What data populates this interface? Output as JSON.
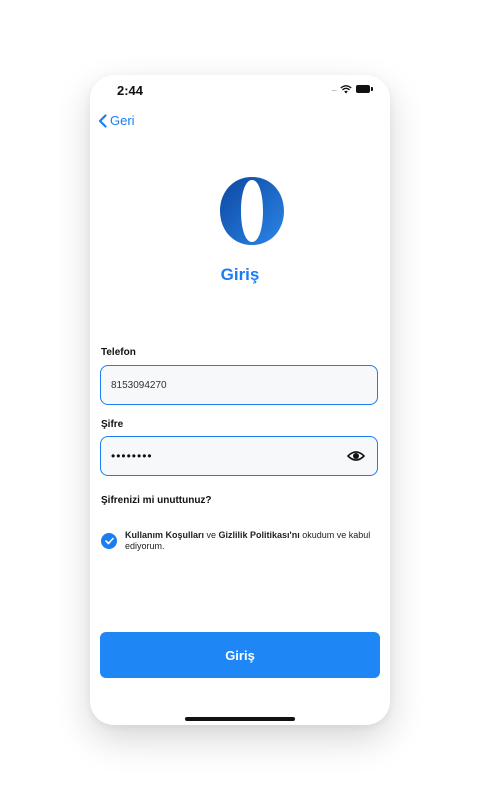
{
  "status_bar": {
    "time": "2:44",
    "signal_dots": "....",
    "icons": [
      "signal-dots-icon",
      "wifi-icon",
      "battery-icon"
    ]
  },
  "nav": {
    "back_label": "Geri",
    "back_icon": "chevron-left-icon"
  },
  "logo": {
    "icon": "brand-logo-icon"
  },
  "title": "Giriş",
  "form": {
    "phone": {
      "label": "Telefon",
      "value": "8153094270"
    },
    "password": {
      "label": "Şifre",
      "value": "••••••••",
      "toggle_icon": "eye-icon"
    }
  },
  "forgot_password": "Şifrenizi mi unuttunuz?",
  "terms": {
    "checked": true,
    "terms_link": "Kullanım Koşulları",
    "connector": " ve ",
    "privacy_link": "Gizlilik Politikası'nı",
    "suffix": " okudum ve kabul ediyorum."
  },
  "submit_label": "Giriş",
  "colors": {
    "accent": "#1a7ef0",
    "button": "#1f86f5",
    "text": "#111111"
  }
}
